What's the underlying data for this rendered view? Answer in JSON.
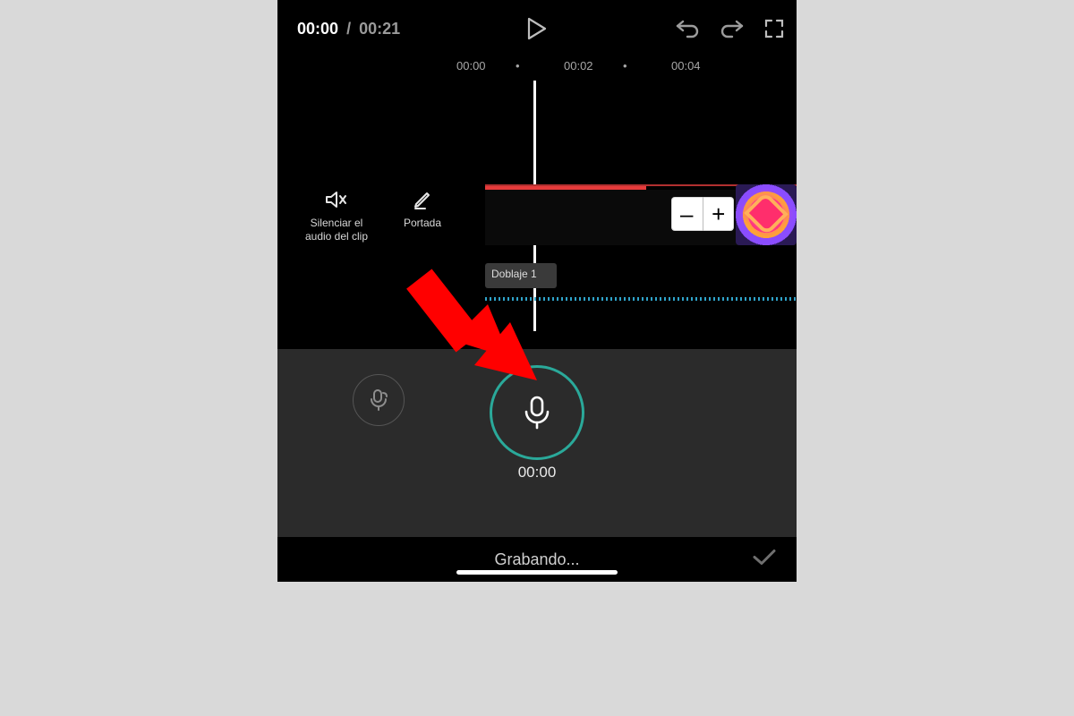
{
  "colors": {
    "accent": "#2aa99a",
    "annotation": "#ff0000"
  },
  "transport": {
    "current": "00:00",
    "total": "00:21",
    "separator": "/"
  },
  "ruler": {
    "t0": "00:00",
    "t2": "00:02",
    "t4": "00:04",
    "dot": "•"
  },
  "sideTools": {
    "mute": {
      "label": "Silenciar el audio del clip"
    },
    "cover": {
      "label": "Portada"
    }
  },
  "zoom": {
    "minus": "–",
    "plus": "+"
  },
  "timeline": {
    "dubClipLabel": "Doblaje 1"
  },
  "record": {
    "elapsed": "00:00"
  },
  "bottom": {
    "status": "Grabando..."
  },
  "icons": {
    "play": "play-icon",
    "undo": "undo-icon",
    "redo": "redo-icon",
    "fullscreen": "fullscreen-icon",
    "speakerMute": "speaker-mute-icon",
    "pencil": "pencil-icon",
    "mic": "microphone-icon",
    "micVoice": "voice-change-icon",
    "check": "check-icon"
  }
}
